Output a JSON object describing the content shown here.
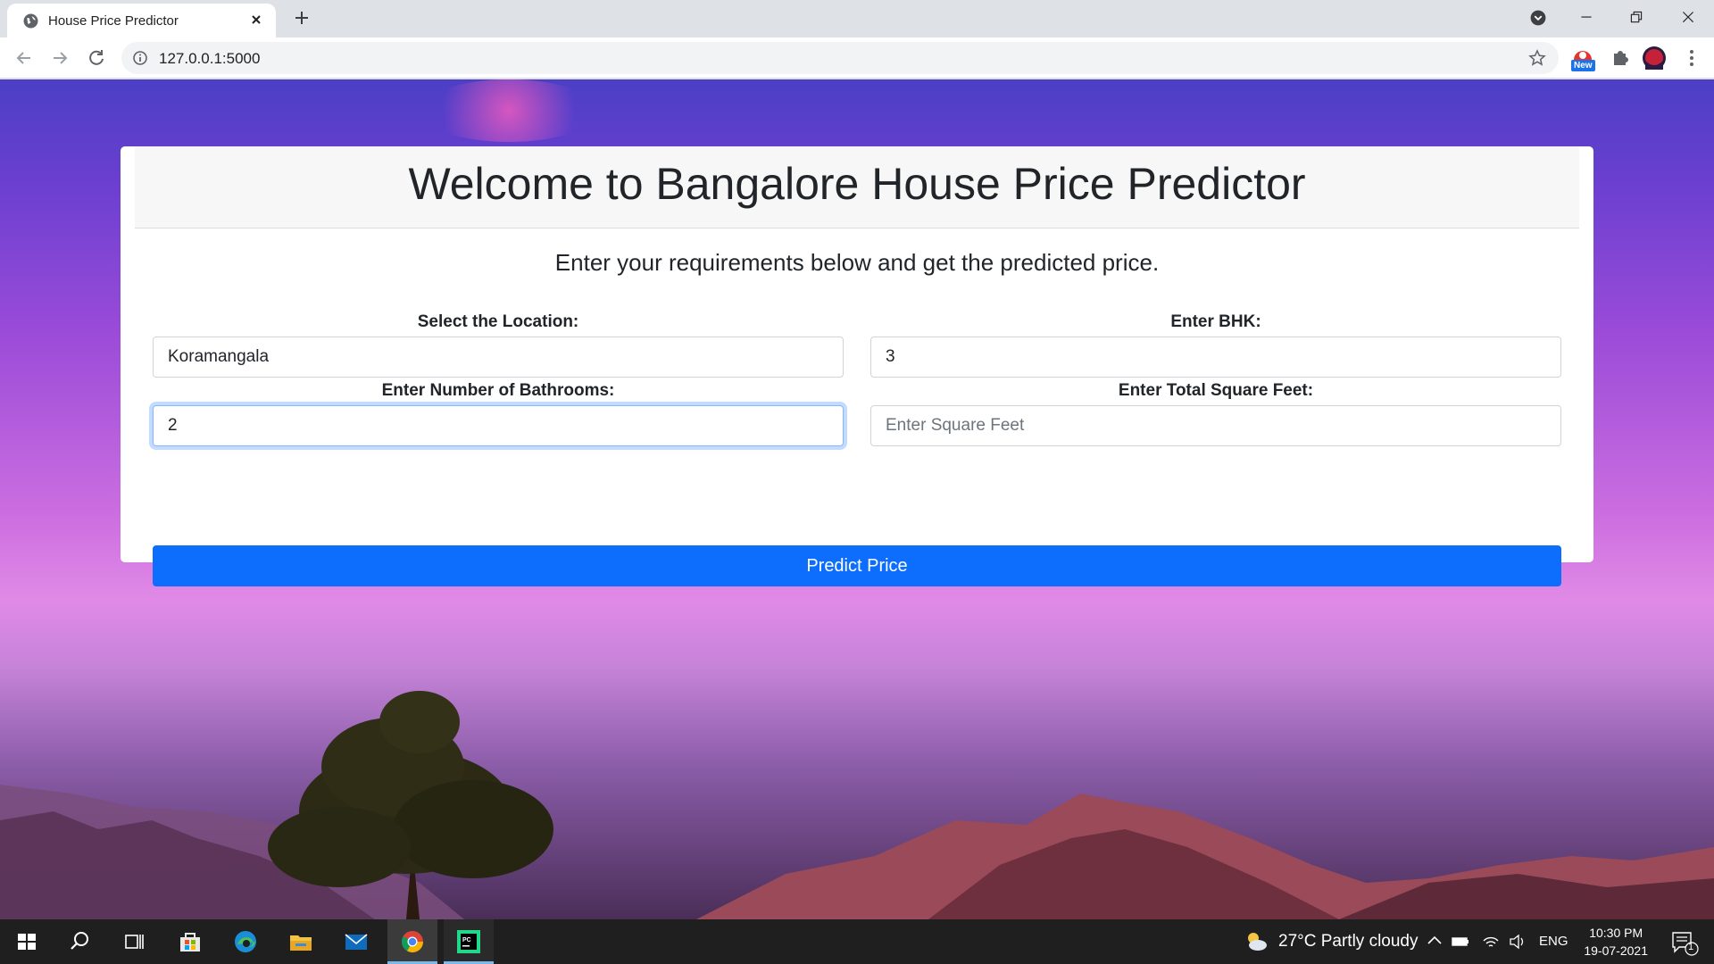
{
  "browser": {
    "tab_title": "House Price Predictor",
    "url": "127.0.0.1:5000",
    "extension_badge": "New"
  },
  "page": {
    "title": "Welcome to Bangalore House Price Predictor",
    "subtitle": "Enter your requirements below and get the predicted price.",
    "location_label": "Select the Location:",
    "location_value": "Koramangala",
    "bhk_label": "Enter BHK:",
    "bhk_value": "3",
    "bath_label": "Enter Number of Bathrooms:",
    "bath_value": "2",
    "sqft_label": "Enter Total Square Feet:",
    "sqft_placeholder": "Enter Square Feet",
    "predict_button": "Predict Price"
  },
  "taskbar": {
    "weather": "27°C  Partly cloudy",
    "language": "ENG",
    "time": "10:30 PM",
    "date": "19-07-2021",
    "notification_count": "1"
  }
}
